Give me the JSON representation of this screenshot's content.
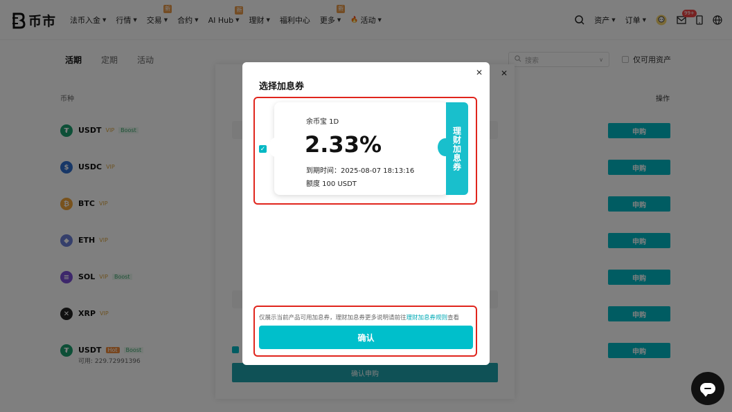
{
  "nav": {
    "logo_text": "币市",
    "items": [
      {
        "label": "法币入金",
        "caret": true,
        "new": false
      },
      {
        "label": "行情",
        "caret": true,
        "new": false
      },
      {
        "label": "交易",
        "caret": true,
        "new": true
      },
      {
        "label": "合约",
        "caret": true,
        "new": false
      },
      {
        "label": "AI Hub",
        "caret": true,
        "new": true
      },
      {
        "label": "理财",
        "caret": true,
        "new": false
      },
      {
        "label": "福利中心",
        "caret": false,
        "new": false
      },
      {
        "label": "更多",
        "caret": true,
        "new": true
      },
      {
        "label": "活动",
        "caret": true,
        "new": false
      }
    ],
    "new_badge": "新",
    "right": {
      "assets": "资产",
      "orders": "订单",
      "mail_count": "99+"
    }
  },
  "page": {
    "tabs": [
      "活期",
      "定期",
      "活动"
    ],
    "search_placeholder": "搜索",
    "available_only": "仅可用资产",
    "col_coin": "币种",
    "col_action": "操作",
    "buy_label": "申购",
    "coins": [
      {
        "symbol": "USDT",
        "vip": "VIP",
        "tag": "Boost",
        "hot": "",
        "sub": "",
        "color": "#1a9f6f",
        "glyph": "₮"
      },
      {
        "symbol": "USDC",
        "vip": "VIP",
        "tag": "",
        "hot": "",
        "sub": "",
        "color": "#2f6fcf",
        "glyph": "$"
      },
      {
        "symbol": "BTC",
        "vip": "VIP",
        "tag": "",
        "hot": "",
        "sub": "",
        "color": "#f0a43a",
        "glyph": "₿"
      },
      {
        "symbol": "ETH",
        "vip": "VIP",
        "tag": "",
        "hot": "",
        "sub": "",
        "color": "#6a7fd6",
        "glyph": "◆"
      },
      {
        "symbol": "SOL",
        "vip": "VIP",
        "tag": "Boost",
        "hot": "",
        "sub": "",
        "color": "#7b4fd6",
        "glyph": "≡"
      },
      {
        "symbol": "XRP",
        "vip": "VIP",
        "tag": "",
        "hot": "",
        "sub": "",
        "color": "#222222",
        "glyph": "✕"
      },
      {
        "symbol": "USDT",
        "vip": "",
        "tag": "Boost",
        "hot": "Hot",
        "sub": "可用: 229.72991396",
        "color": "#1a9f6f",
        "glyph": "₮"
      }
    ],
    "drawer_confirm": "确认申购"
  },
  "modal": {
    "title": "选择加息券",
    "coupon": {
      "product": "余币宝 1D",
      "rate": "2.33%",
      "expire": "到期时间：2025-08-07 18:13:16",
      "amount": "额度 100 USDT",
      "side_label": "理财加息券",
      "checked": true
    },
    "footer_note_prefix": "仅展示当前产品可用加息券，理财加息券更多说明请前往",
    "footer_link": "理财加息券规则",
    "footer_note_suffix": "查看",
    "confirm": "确认"
  },
  "colors": {
    "accent": "#00bfcb",
    "highlight_border": "#e0241c"
  }
}
